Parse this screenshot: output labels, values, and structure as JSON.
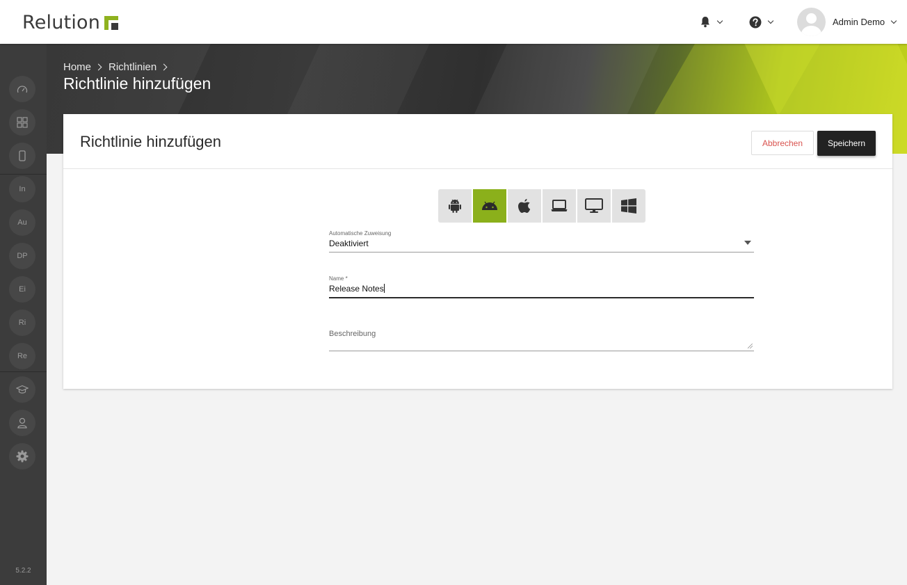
{
  "app": {
    "name": "Relution",
    "version": "5.2.2"
  },
  "topbar": {
    "user_name": "Admin Demo",
    "icons": [
      "bell-icon",
      "help-icon",
      "avatar"
    ]
  },
  "sidebar": {
    "items": [
      {
        "id": "dashboard",
        "icon": "speedometer-icon",
        "label": ""
      },
      {
        "id": "apps",
        "icon": "grid-icon",
        "label": ""
      },
      {
        "id": "devices",
        "icon": "smartphone-icon",
        "label": ""
      },
      {
        "id": "in",
        "label": "In"
      },
      {
        "id": "au",
        "label": "Au"
      },
      {
        "id": "dp",
        "label": "DP"
      },
      {
        "id": "ei",
        "label": "Ei"
      },
      {
        "id": "ri",
        "label": "Ri"
      },
      {
        "id": "re",
        "label": "Re"
      },
      {
        "id": "education",
        "icon": "graduation-cap-icon",
        "label": ""
      },
      {
        "id": "users",
        "icon": "user-icon",
        "label": ""
      },
      {
        "id": "settings",
        "icon": "gear-icon",
        "label": ""
      }
    ]
  },
  "hero": {
    "breadcrumb": [
      "Home",
      "Richtlinien"
    ],
    "title": "Richtlinie hinzufügen"
  },
  "card": {
    "title": "Richtlinie hinzufügen",
    "cancel_label": "Abbrechen",
    "save_label": "Speichern",
    "platforms": [
      {
        "name": "android-legacy",
        "icon": "android-robot-icon",
        "active": false
      },
      {
        "name": "android-enterprise",
        "icon": "android-head-icon",
        "active": true
      },
      {
        "name": "ios",
        "icon": "apple-icon",
        "active": false
      },
      {
        "name": "macos",
        "icon": "laptop-icon",
        "active": false
      },
      {
        "name": "desktop",
        "icon": "monitor-icon",
        "active": false
      },
      {
        "name": "windows",
        "icon": "windows-icon",
        "active": false
      }
    ],
    "assignment": {
      "label": "Automatische Zuweisung",
      "value": "Deaktiviert"
    },
    "name_field": {
      "label": "Name *",
      "value": "Release Notes"
    },
    "description": {
      "label": "Beschreibung",
      "value": ""
    }
  },
  "colors": {
    "accent": "#8bb01b",
    "sidebar": "#3c3c3c",
    "cancel_text": "#d9534f",
    "save_bg": "#222222"
  }
}
